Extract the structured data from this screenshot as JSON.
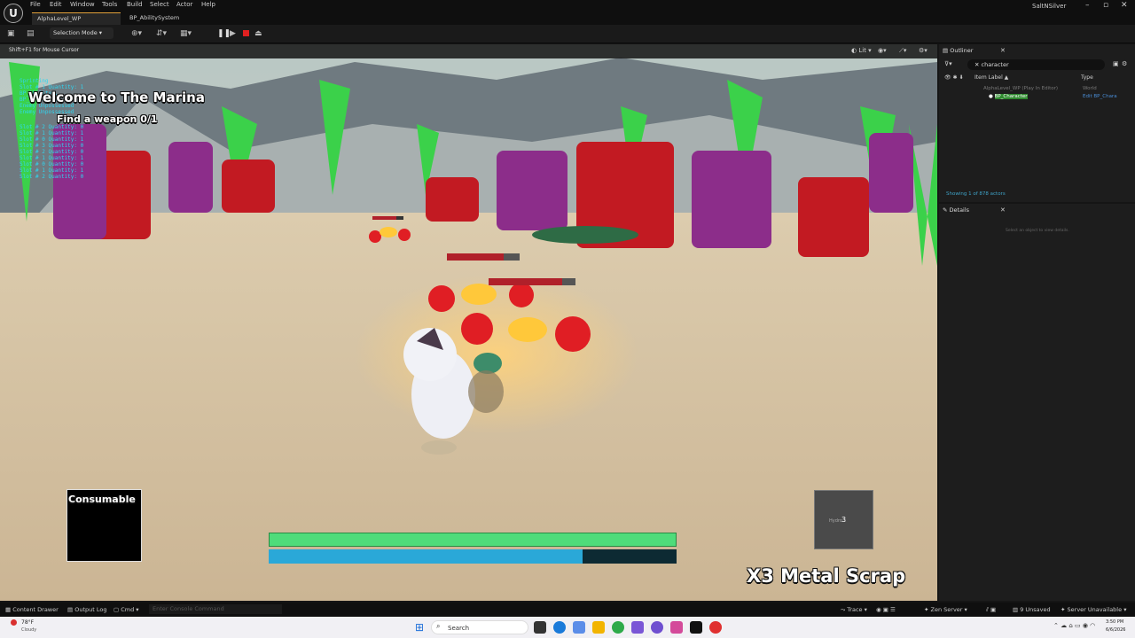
{
  "menu": {
    "logo": "U",
    "items": [
      "File",
      "Edit",
      "Window",
      "Tools",
      "Build",
      "Select",
      "Actor",
      "Help"
    ]
  },
  "tabs": [
    "AlphaLevel_WP",
    "BP_AbilitySystem"
  ],
  "user": "SaltNSilver",
  "toolbar": {
    "selection_mode": "Selection Mode"
  },
  "viewport": {
    "hint": "Shift+F1 for Mouse Cursor",
    "lit": "Lit",
    "hud_title": "Welcome to The Marina",
    "quest": "Find a weapon 0/1",
    "debug_lines": [
      "Sprinting",
      "Slot # 1 Quantity: 1",
      "BP_Ability...",
      "BP_Ability...",
      "Enemy Unpossessed",
      "Enemy Unpossessed",
      "Slot # 2 Quantity: 0",
      "Slot # 1 Quantity: 1",
      "Slot # 0 Quantity: 1",
      "Slot # 3 Quantity: 0",
      "Slot # 2 Quantity: 0",
      "Slot # 1 Quantity: 1",
      "Slot # 0 Quantity: 0",
      "Slot # 1 Quantity: 1",
      "Slot # 2 Quantity: 0"
    ],
    "consumable_label": "Consumable",
    "pickup_text": "X3 Metal Scrap",
    "slot_label": "Hydro...",
    "slot_count": "3",
    "health_fill": 1.0,
    "mana_fill": 0.77,
    "enemy_bars": [
      0.78,
      0.78,
      0.85
    ]
  },
  "outliner": {
    "title": "Outliner",
    "search": "character",
    "col_label": "Item Label ▲",
    "col_type": "Type",
    "rows": [
      {
        "label": "AlphaLevel_WP (Play In Editor)",
        "type": "World"
      },
      {
        "label": "BP_Character",
        "type": "Edit BP_Chara"
      }
    ],
    "status": "Showing 1 of 878 actors"
  },
  "details": {
    "title": "Details",
    "empty": "Select an object to view details."
  },
  "statusbar": {
    "content_drawer": "Content Drawer",
    "output_log": "Output Log",
    "cmd": "Cmd",
    "console_placeholder": "Enter Console Command",
    "trace": "Trace",
    "zen": "Zen Server",
    "unsaved": "9 Unsaved",
    "server": "Server Unavailable"
  },
  "taskbar": {
    "weather_temp": "78°F",
    "weather_desc": "Cloudy",
    "search": "Search",
    "time": "3:50 PM",
    "date": "6/6/2026"
  },
  "colors": {
    "health": "#4fdc7a",
    "mana": "#2aa8d8",
    "accent": "#e2a13a"
  }
}
